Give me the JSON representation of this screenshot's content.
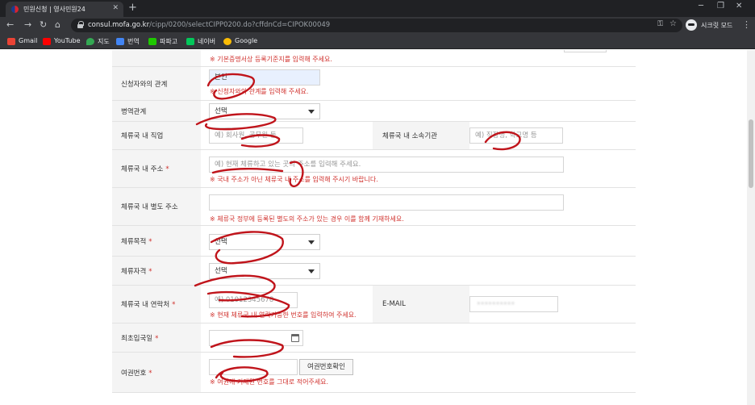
{
  "browser": {
    "tab_title": "민원신청 | 영사민원24",
    "url_host": "consul.mofa.go.kr",
    "url_path": "/cipp/0200/selectCIPP0200.do?cffdnCd=CIPOK00049",
    "profile_label": "시크릿 모드",
    "bookmarks": [
      {
        "label": "Gmail",
        "color": "#ea4335"
      },
      {
        "label": "YouTube",
        "color": "#ff0000"
      },
      {
        "label": "지도",
        "color": "#34a853"
      },
      {
        "label": "번역",
        "color": "#4285f4"
      },
      {
        "label": "파파고",
        "color": "#1ec800"
      },
      {
        "label": "네이버",
        "color": "#03c75a"
      },
      {
        "label": "Google",
        "color": "#fbbc05"
      }
    ]
  },
  "form": {
    "top_note": "※ 기본증명서상 등록기준지를 입력해 주세요.",
    "relation": {
      "label": "신청자와의 관계",
      "value": "본인",
      "note": "※ 신청자와의 관계를 입력해 주세요."
    },
    "military": {
      "label": "병역관계",
      "selected": "선택"
    },
    "job": {
      "label": "체류국 내 직업",
      "placeholder": "예) 회사원, 공무원 등"
    },
    "org": {
      "label": "체류국 내 소속기관",
      "placeholder": "예) 직장명, 학교명 등"
    },
    "address": {
      "label": "체류국 내 주소",
      "placeholder": "예) 현재 체류하고 있는 곳의 주소를 입력해 주세요.",
      "note": "※ 국내 주소가 아닌 체류국 내 주소를 입력해 주시기 바랍니다."
    },
    "alt_address": {
      "label": "체류국 내 별도 주소",
      "note": "※ 체류국 정부에 등록된 별도의 주소가 있는 경우 이를 함께 기재하세요."
    },
    "purpose": {
      "label": "체류목적",
      "selected": "선택"
    },
    "status": {
      "label": "체류자격",
      "selected": "선택"
    },
    "phone": {
      "label": "체류국 내 연락처",
      "placeholder": "예) 01012345678",
      "note": "※ 현재 체류국 내 연락가능한 번호를 입력하여 주세요."
    },
    "email": {
      "label": "E-MAIL",
      "value": "••••••••••"
    },
    "first_entry": {
      "label": "최초입국일"
    },
    "passport": {
      "label": "여권번호",
      "button": "여권번호확인",
      "note": "※ 여권에 기재된 번호를 그대로 적어주세요."
    },
    "required_mark": "*"
  },
  "colors": {
    "required": "#d0312d",
    "scribble": "#c0141b"
  }
}
